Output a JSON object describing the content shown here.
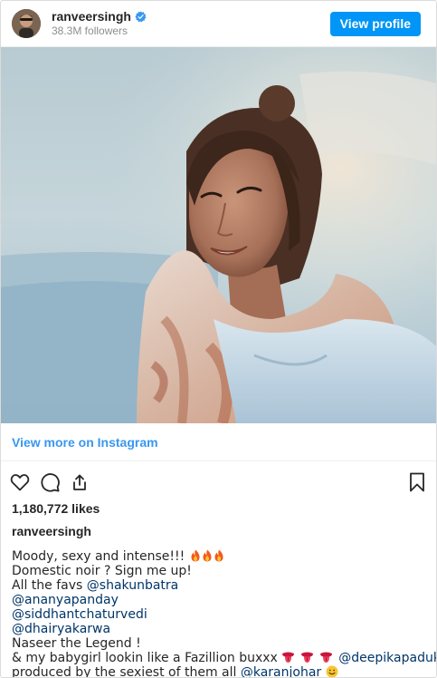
{
  "header": {
    "username": "ranveersingh",
    "followers": "38.3M followers",
    "view_profile_label": "View profile",
    "verified_icon": "verified-badge-icon"
  },
  "media": {
    "subject": "woman-smiling-with-shawl",
    "icon": "post-photo"
  },
  "more": {
    "link_label": "View more on Instagram"
  },
  "actions": {
    "icons": [
      "heart-icon",
      "comment-icon",
      "share-icon",
      "bookmark-icon"
    ]
  },
  "likes": "1,180,772 likes",
  "owner": "ranveersingh",
  "caption": {
    "line1": "Moody, sexy and intense!!!",
    "line2": "Domestic noir ? Sign me up!",
    "line3_prefix": "All the favs ",
    "mention1": "@shakunbatra",
    "mention2": "@ananyapanday",
    "mention3": "@siddhantchaturvedi",
    "mention4": "@dhairyakarwa",
    "line7": "Naseer the Legend !",
    "line8_prefix": "& my babygirl lookin like a Fazillion buxxx",
    "mention5": "@deepikapadukone",
    "line9_prefix": "produced by the sexiest of them all ",
    "mention6": "@karanjohar"
  },
  "colors": {
    "accent": "#0095f6",
    "link": "#3897f0",
    "text": "#262626",
    "muted": "#8e8e8e",
    "border": "#dbdbdb"
  }
}
